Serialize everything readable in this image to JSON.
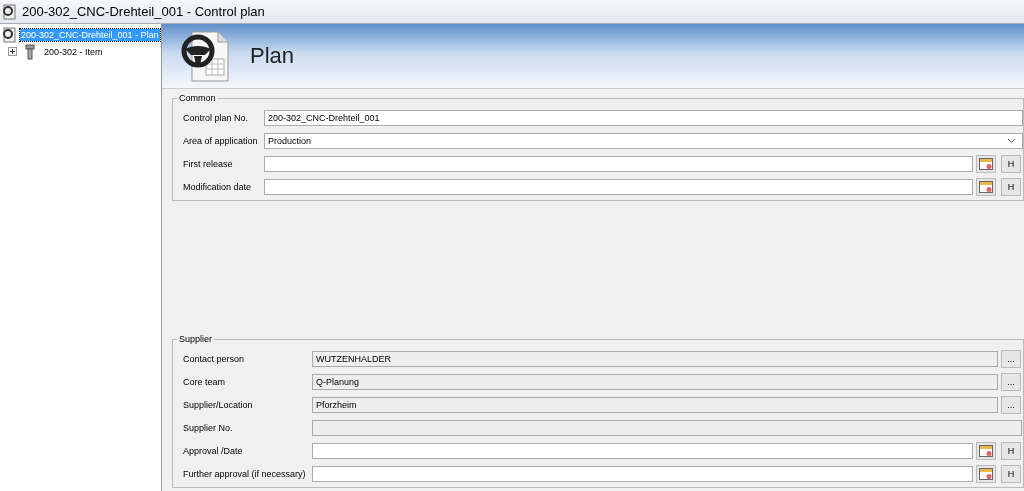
{
  "window": {
    "title": "200-302_CNC-Drehteil_001 - Control plan"
  },
  "tree": [
    {
      "label": "200-302_CNC-Drehteil_001 - Plan",
      "selected": true,
      "children": [
        {
          "label": "200-302 - Item",
          "selected": false,
          "expanded": false
        }
      ]
    }
  ],
  "header": {
    "title": "Plan"
  },
  "common": {
    "title": "Common",
    "fields": [
      {
        "kind": "text",
        "label": "Control plan No.",
        "value": "200-302_CNC-Drehteil_001"
      },
      {
        "kind": "dropdown",
        "label": "Area of application",
        "value": "Production"
      },
      {
        "kind": "date",
        "label": "First release",
        "button": "H"
      },
      {
        "kind": "date",
        "label": "Modification date",
        "button": "H"
      }
    ]
  },
  "supplier": {
    "title": "Supplier",
    "fields": [
      {
        "kind": "lookup",
        "label": "Contact person",
        "value": "WUTZENHALDER",
        "button": "..."
      },
      {
        "kind": "lookup",
        "label": "Core team",
        "value": "Q-Planung",
        "button": "..."
      },
      {
        "kind": "lookup",
        "label": "Supplier/Location",
        "value": "Pforzheim",
        "button": "..."
      },
      {
        "kind": "readonly",
        "label": "Supplier No."
      },
      {
        "kind": "date",
        "label": "Approval /Date",
        "button": "H"
      },
      {
        "kind": "date",
        "label": "Further approval (if necessary)",
        "button": "H"
      }
    ]
  }
}
